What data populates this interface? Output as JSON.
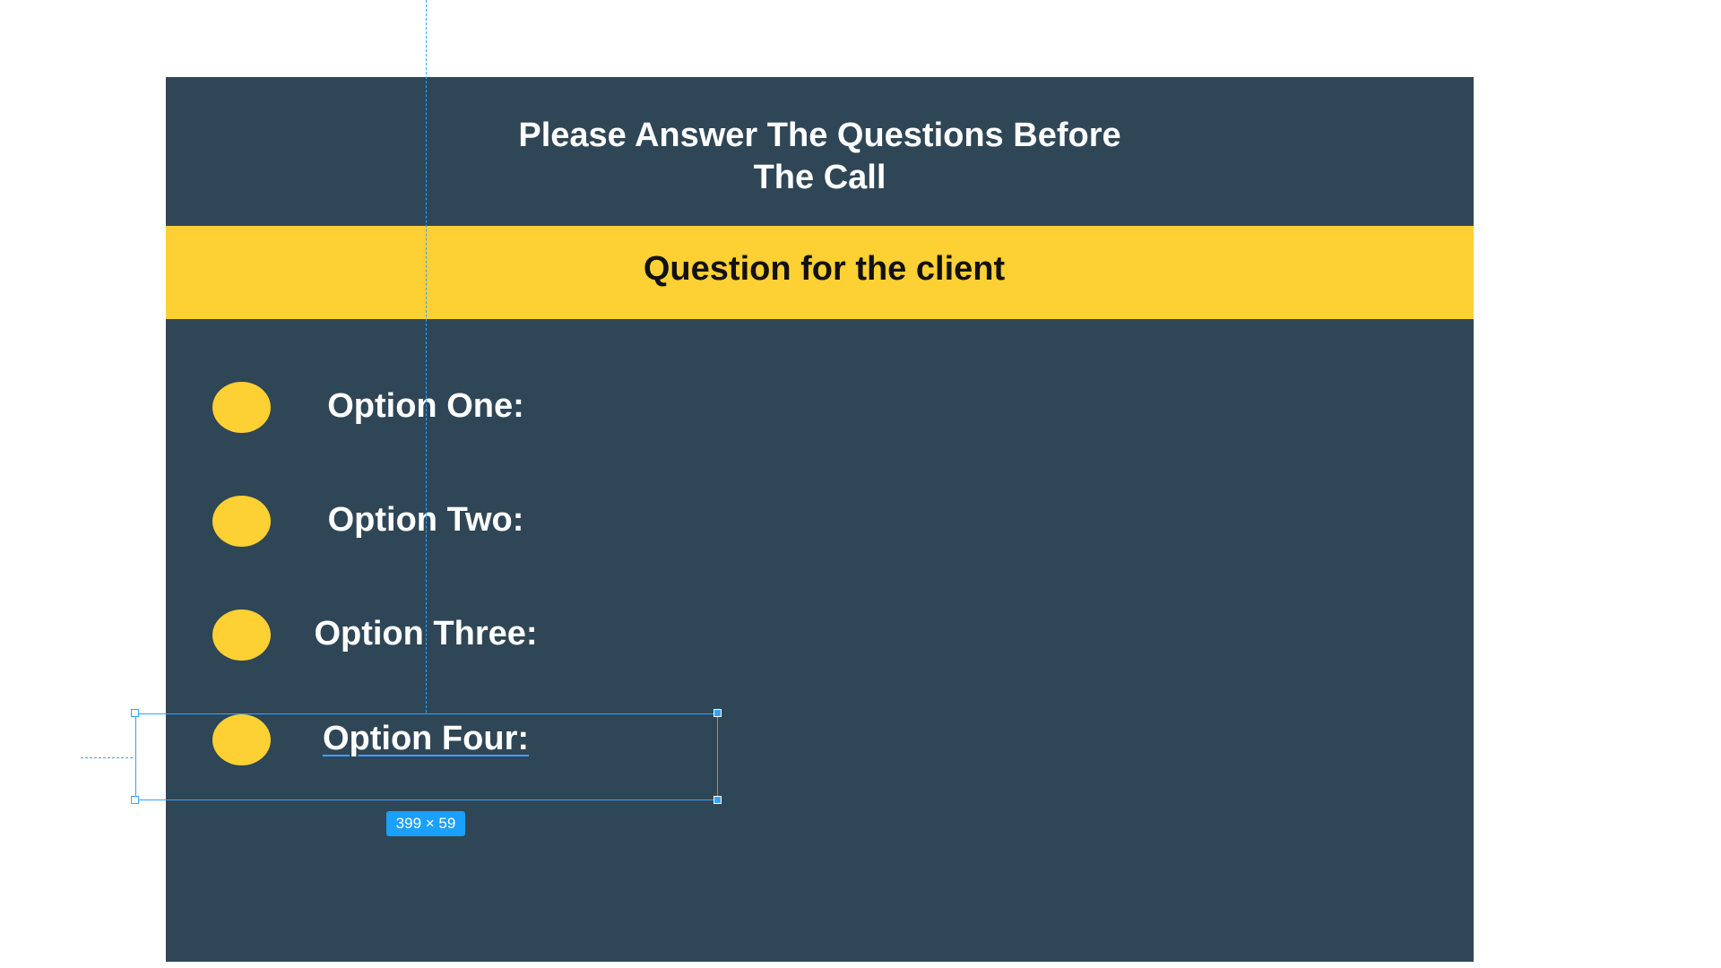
{
  "header": {
    "title_line1": "Please Answer The Questions Before",
    "title_line2": "The Call"
  },
  "question_band": {
    "label": "Question for the client"
  },
  "options": [
    {
      "label": "Option One:"
    },
    {
      "label": "Option Two:"
    },
    {
      "label": "Option Three:"
    },
    {
      "label": "Option Four:"
    }
  ],
  "selection": {
    "size_label": "399 × 59"
  },
  "colors": {
    "card_background": "#2f4656",
    "accent_yellow": "#fdd033",
    "selection_blue": "#35a4ff"
  }
}
